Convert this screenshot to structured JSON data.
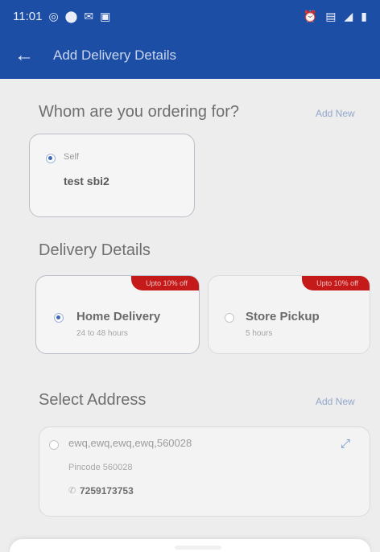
{
  "status_bar": {
    "time": "11:01",
    "icons_left": [
      "whatsapp-icon",
      "location-icon",
      "gmail-icon",
      "gallery-icon"
    ],
    "icons_right": [
      "alarm-icon",
      "data-icon",
      "signal-icon",
      "battery-icon"
    ]
  },
  "header": {
    "title": "Add Delivery Details"
  },
  "recipient": {
    "section_title": "Whom are you ordering for?",
    "add_new": "Add New",
    "selected_label": "Self",
    "selected_name": "test sbi2"
  },
  "delivery": {
    "section_title": "Delivery Details",
    "options": [
      {
        "title": "Home Delivery",
        "subtitle": "24 to 48 hours",
        "badge": "Upto 10% off",
        "selected": true
      },
      {
        "title": "Store Pickup",
        "subtitle": "5 hours",
        "badge": "Upto 10% off",
        "selected": false
      }
    ]
  },
  "address": {
    "section_title": "Select Address",
    "add_new": "Add New",
    "line": "ewq,ewq,ewq,ewq,560028",
    "pincode": "Pincode 560028",
    "phone": "7259173753"
  },
  "colors": {
    "brand_blue": "#1d4ea6",
    "badge_red": "#c41a1a",
    "overlay": "#ededed"
  }
}
